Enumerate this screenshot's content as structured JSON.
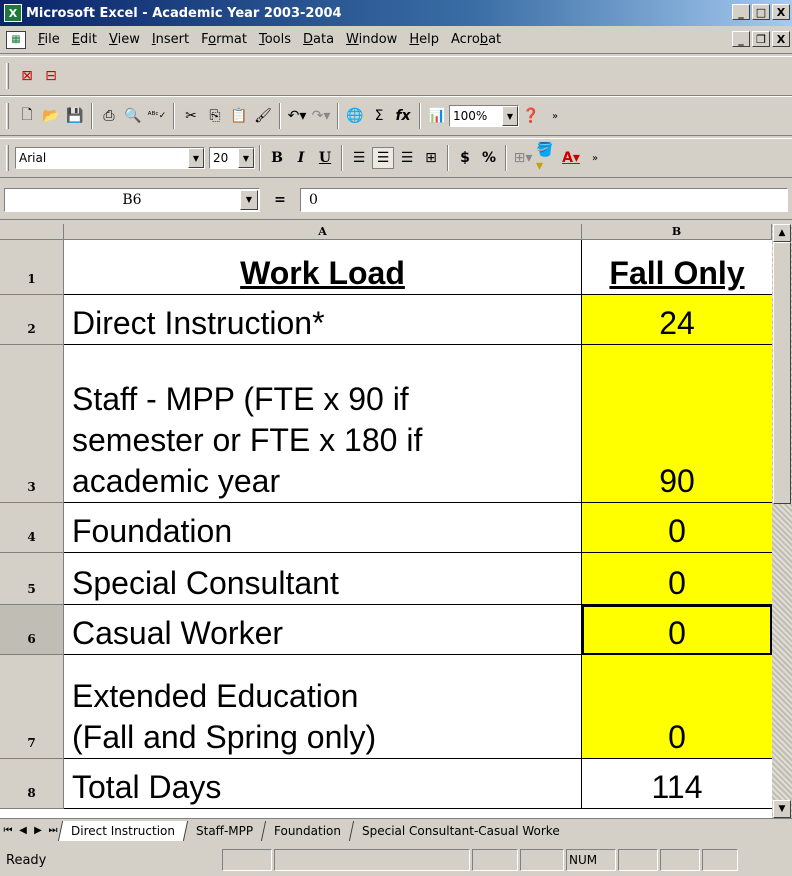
{
  "window": {
    "title": "Microsoft Excel - Academic Year 2003-2004",
    "buttons": {
      "minimize": "_",
      "maximize": "□",
      "close": "X"
    }
  },
  "menu": {
    "items": [
      {
        "label": "File",
        "ul": "F",
        "rest": "ile"
      },
      {
        "label": "Edit",
        "ul": "E",
        "rest": "dit"
      },
      {
        "label": "View",
        "ul": "V",
        "rest": "iew"
      },
      {
        "label": "Insert",
        "ul": "I",
        "rest": "nsert"
      },
      {
        "label": "Format",
        "pre": "F",
        "ul": "o",
        "rest": "rmat"
      },
      {
        "label": "Tools",
        "ul": "T",
        "rest": "ools"
      },
      {
        "label": "Data",
        "ul": "D",
        "rest": "ata"
      },
      {
        "label": "Window",
        "ul": "W",
        "rest": "indow"
      },
      {
        "label": "Help",
        "ul": "H",
        "rest": "elp"
      },
      {
        "label": "Acrobat",
        "pre": "Acro",
        "ul": "b",
        "rest": "at"
      }
    ]
  },
  "formatting": {
    "font": "Arial",
    "size": "20",
    "zoom": "100%"
  },
  "formula_bar": {
    "name_box": "B6",
    "equals": "=",
    "value": "0"
  },
  "columns": {
    "a": "A",
    "b": "B"
  },
  "rows": [
    {
      "num": "1",
      "a": "Work Load",
      "b": "Fall Only"
    },
    {
      "num": "2",
      "a": "Direct Instruction*",
      "b": "24"
    },
    {
      "num": "3",
      "a1": "Staff - MPP (FTE x 90 if",
      "a2": "semester or FTE x 180 if",
      "a3": "academic year",
      "b": "90"
    },
    {
      "num": "4",
      "a": "Foundation",
      "b": "0"
    },
    {
      "num": "5",
      "a": "Special Consultant",
      "b": "0"
    },
    {
      "num": "6",
      "a": "Casual Worker",
      "b": "0"
    },
    {
      "num": "7",
      "a1": "Extended Education",
      "a2": "(Fall and Spring only)",
      "b": "0"
    },
    {
      "num": "8",
      "a": "Total Days",
      "b": "114"
    }
  ],
  "sheets": [
    "Direct Instruction",
    "Staff-MPP",
    "Foundation",
    "Special Consultant-Casual Worke"
  ],
  "status": {
    "ready": "Ready",
    "num": "NUM"
  },
  "colors": {
    "highlight": "#ffff00",
    "titlebar": "#0a246a"
  }
}
